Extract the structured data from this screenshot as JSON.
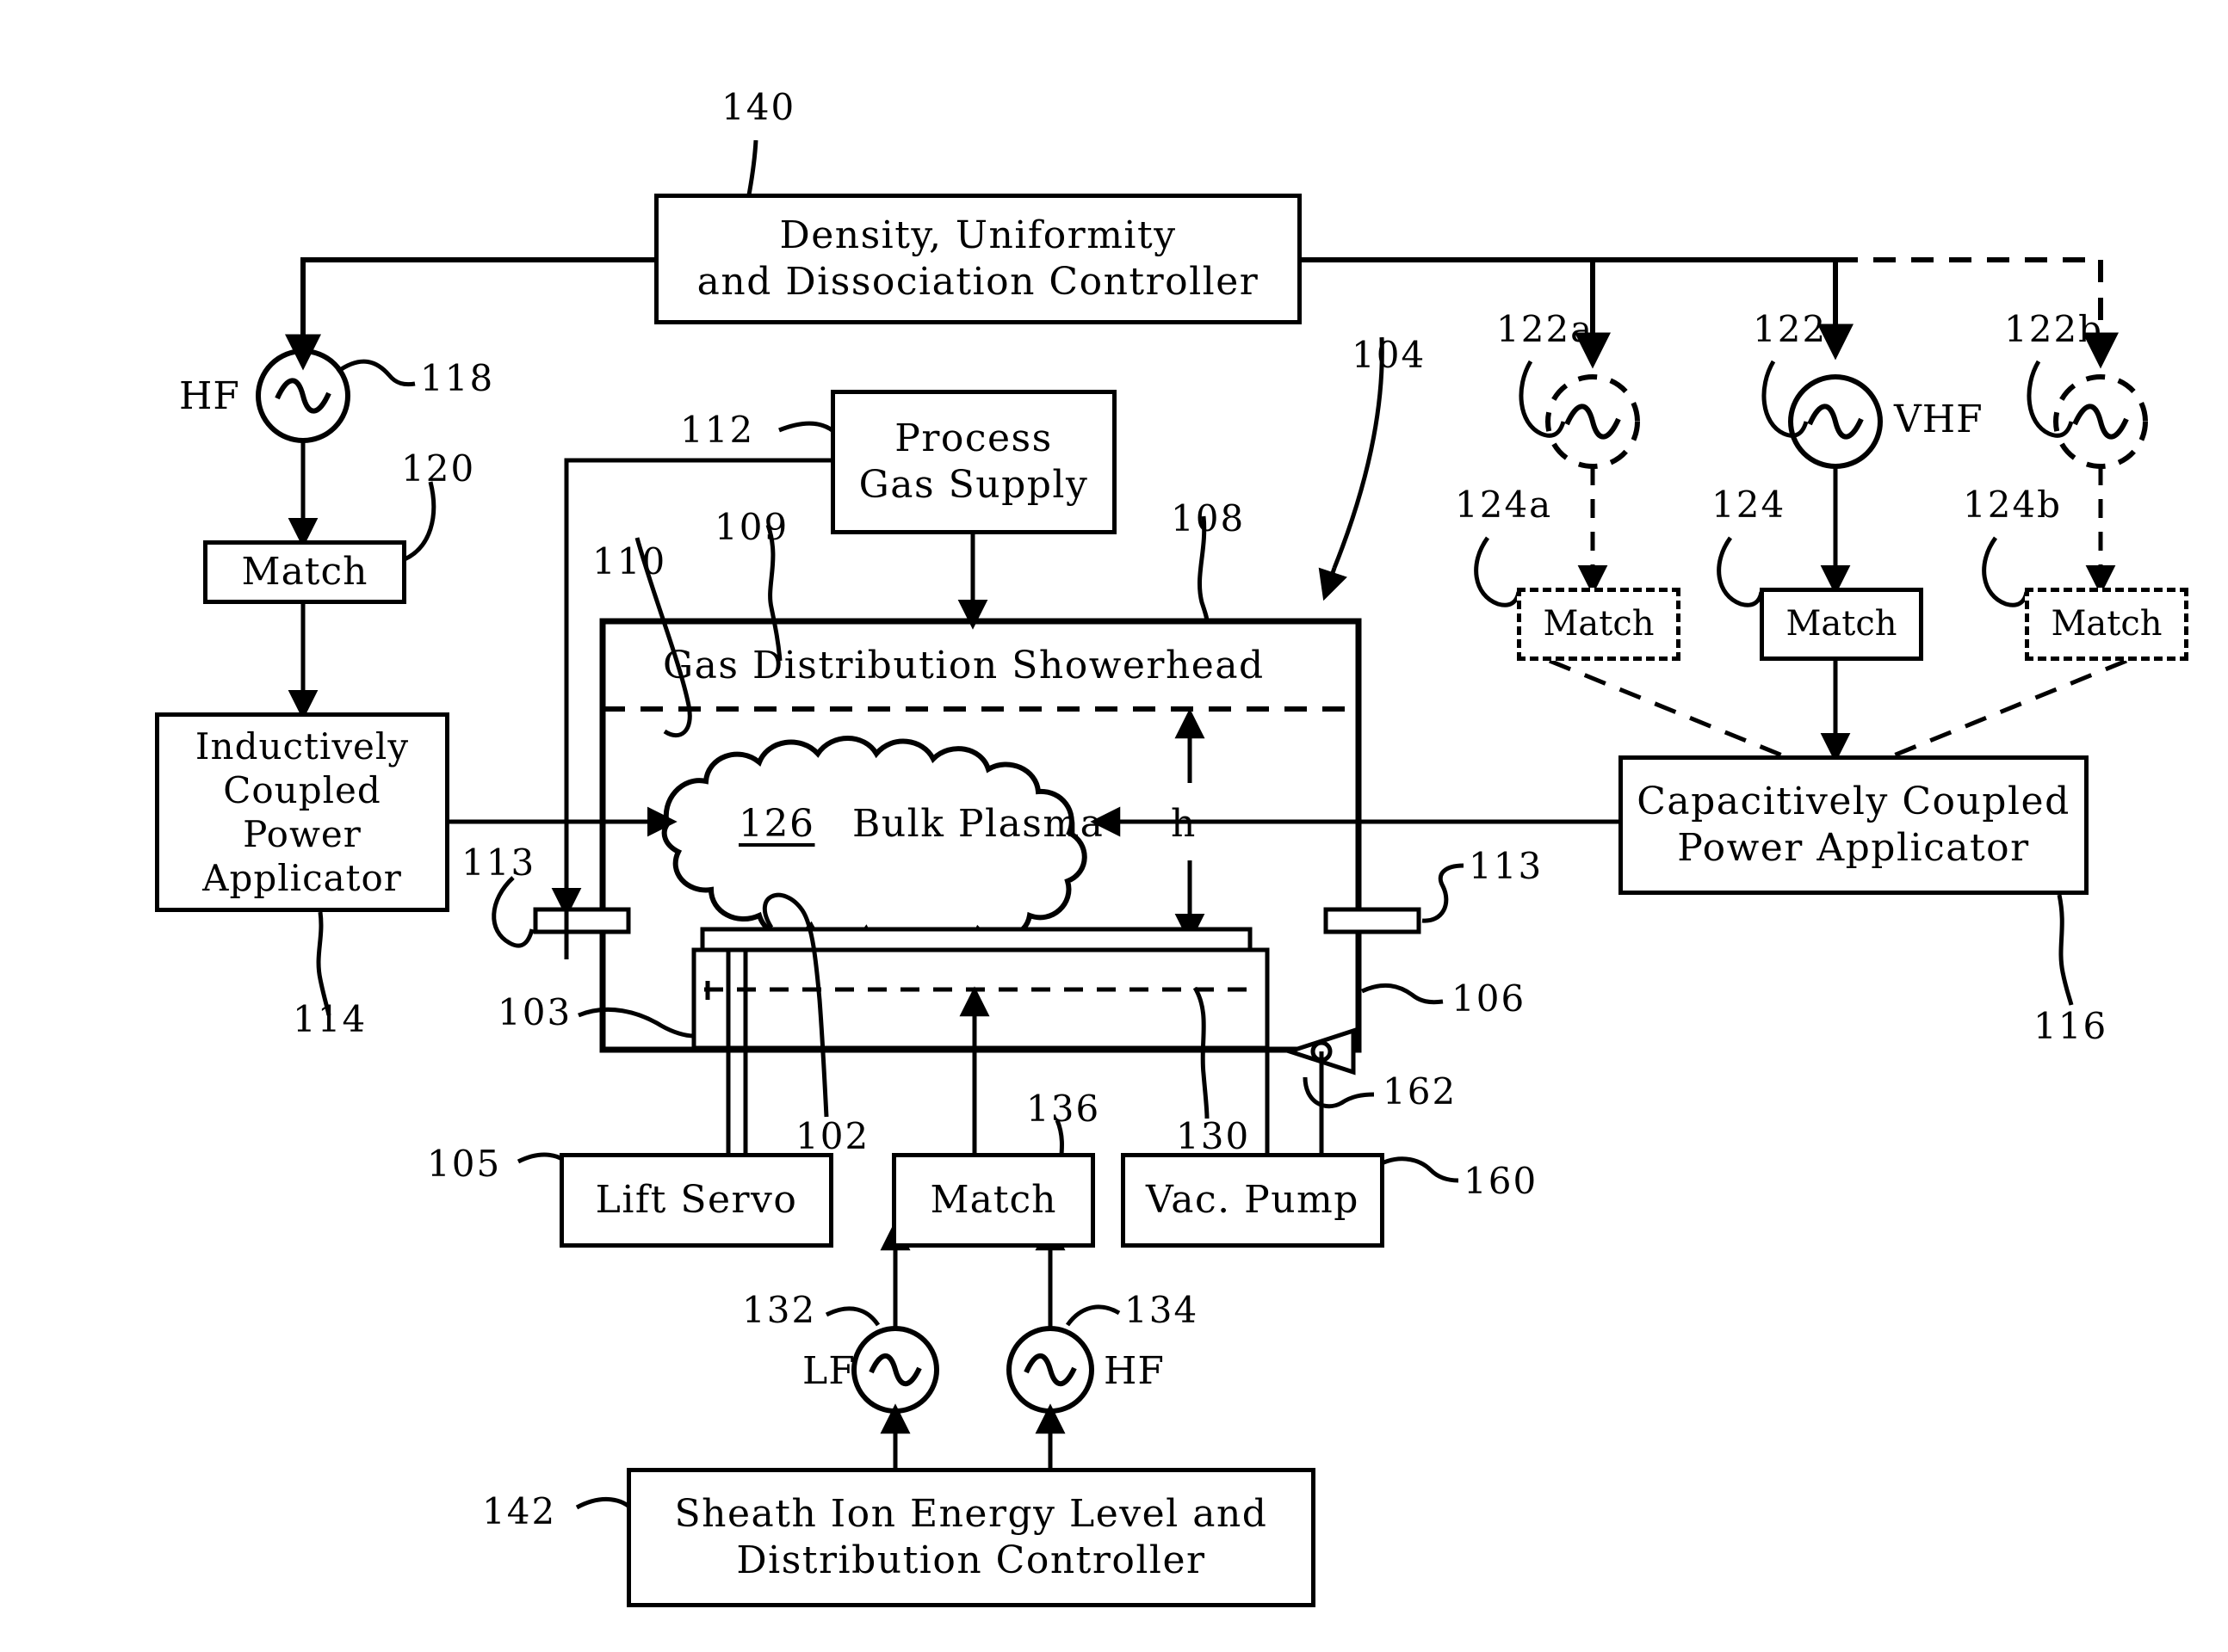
{
  "figure": {
    "type": "plasma-reactor-block-diagram"
  },
  "boxes": {
    "density_controller": {
      "line1": "Density, Uniformity",
      "line2": "and Dissociation Controller",
      "ref": "140"
    },
    "process_gas_supply": {
      "line1": "Process",
      "line2": "Gas Supply",
      "ref": "112"
    },
    "match_left": {
      "label": "Match",
      "ref": "120"
    },
    "inductive_applicator": {
      "line1": "Inductively",
      "line2": "Coupled",
      "line3": "Power",
      "line4": "Applicator",
      "ref": "114"
    },
    "capacitive_applicator": {
      "line1": "Capacitively Coupled",
      "line2": "Power Applicator",
      "ref": "116"
    },
    "match_vhf_a": {
      "label": "Match",
      "ref": "124a"
    },
    "match_vhf": {
      "label": "Match",
      "ref": "124"
    },
    "match_vhf_b": {
      "label": "Match",
      "ref": "124b"
    },
    "lift_servo": {
      "label": "Lift Servo",
      "ref": "105"
    },
    "match_bias": {
      "label": "Match",
      "ref": "136"
    },
    "vac_pump": {
      "label": "Vac. Pump",
      "ref": "160"
    },
    "sheath_controller": {
      "line1": "Sheath Ion Energy Level and",
      "line2": "Distribution Controller",
      "ref": "142"
    }
  },
  "sources": {
    "hf_top_left": {
      "name": "HF",
      "ref": "118",
      "style": "solid"
    },
    "vhf_a": {
      "name": "",
      "ref": "122a",
      "style": "dashed"
    },
    "vhf": {
      "name": "VHF",
      "ref": "122",
      "style": "solid"
    },
    "vhf_b": {
      "name": "",
      "ref": "122b",
      "style": "dashed"
    },
    "lf_bias": {
      "name": "LF",
      "ref": "132",
      "style": "solid"
    },
    "hf_bias": {
      "name": "HF",
      "ref": "134",
      "style": "solid"
    }
  },
  "chamber": {
    "showerhead_label": "Gas Distribution Showerhead",
    "plasma_ref": "126",
    "plasma_label": "Bulk Plasma",
    "gap_label": "h",
    "refs": {
      "showerhead_top": "108",
      "chamber_arrow": "104",
      "showerhead_body": "109",
      "chamber_left_wall": "110",
      "pedestal_base": "103",
      "wafer": "102",
      "pedestal_electrode": "130",
      "chamber_right_wall": "106",
      "throttle_valve": "162",
      "port_left": "113",
      "port_right": "113"
    }
  }
}
